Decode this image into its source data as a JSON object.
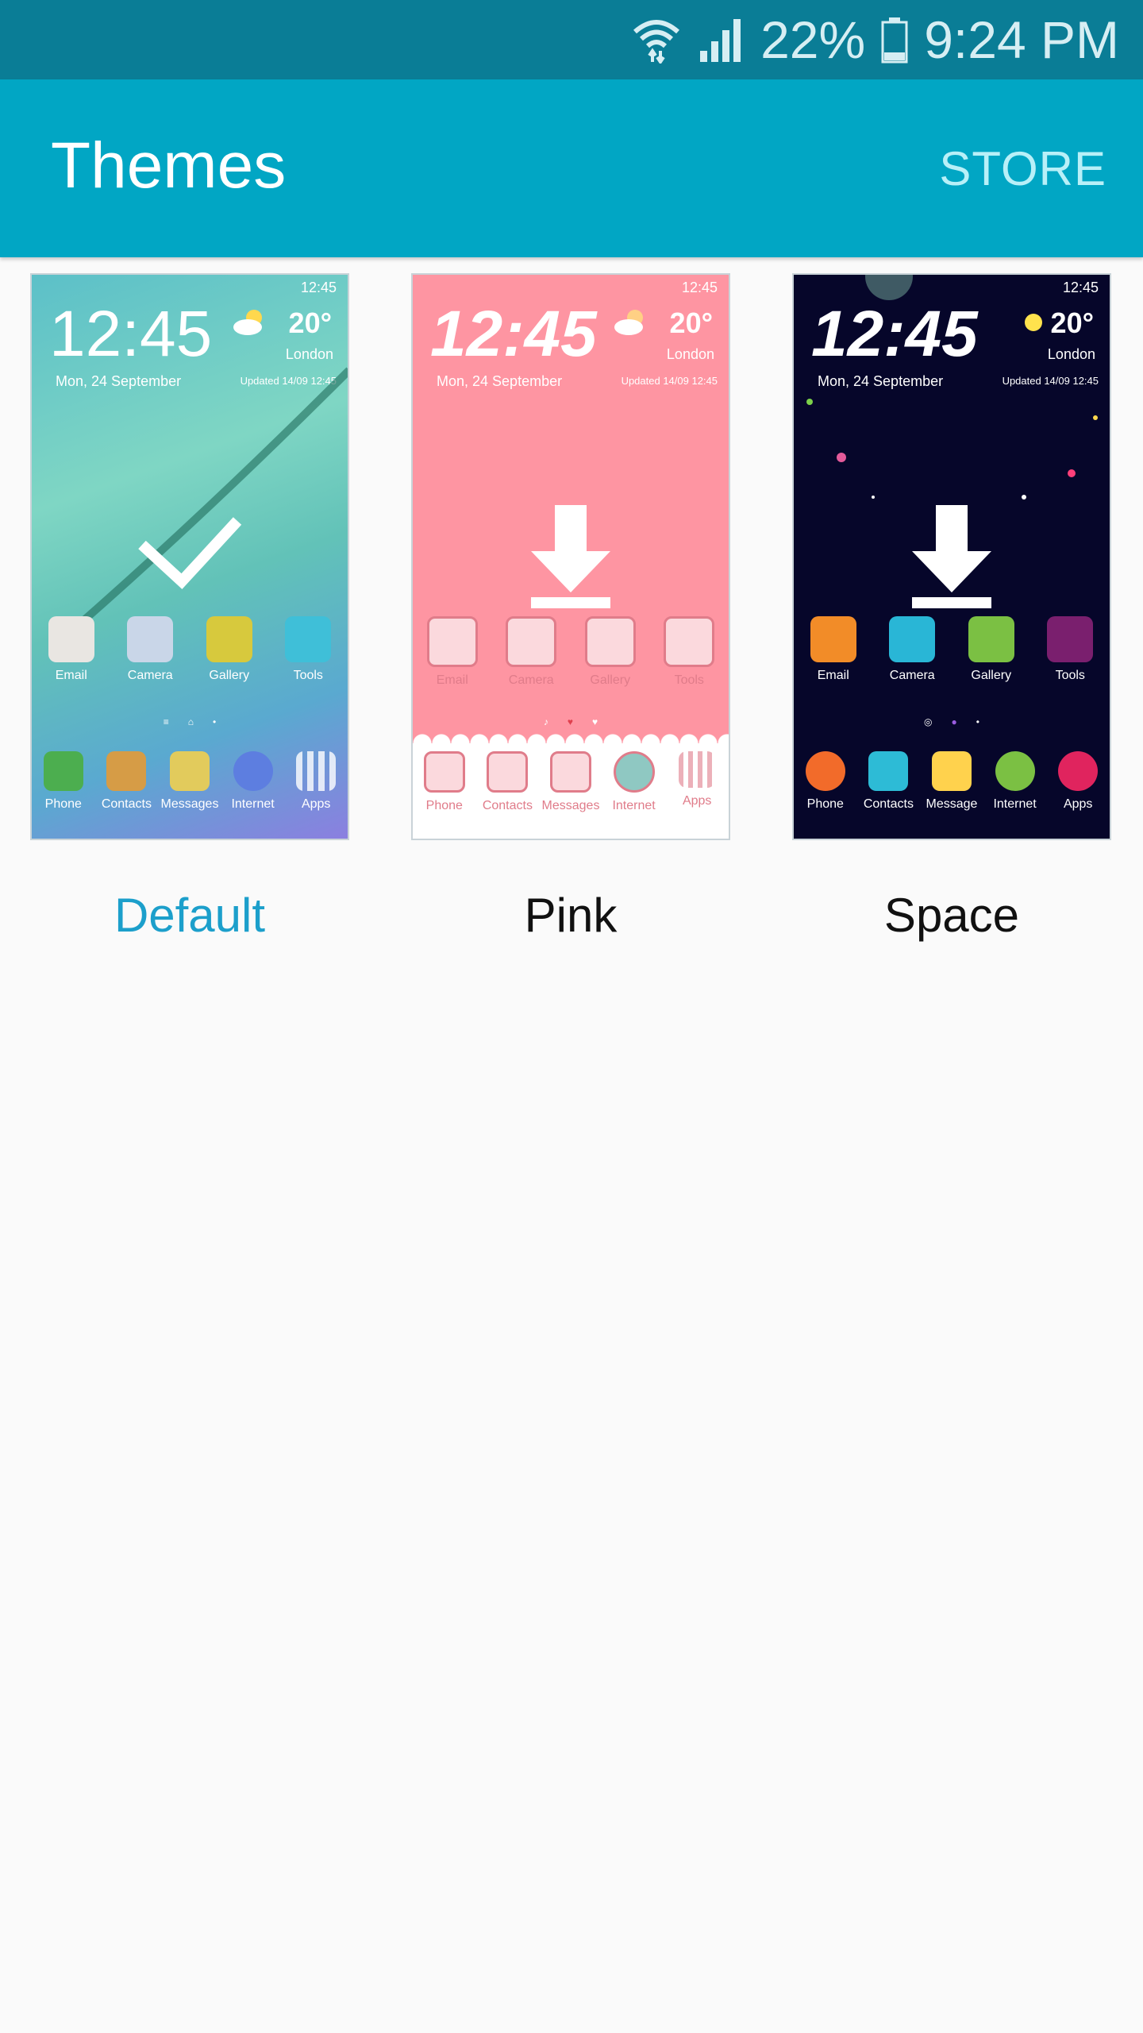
{
  "status_bar": {
    "battery": "22%",
    "time": "9:24 PM"
  },
  "app_bar": {
    "title": "Themes",
    "store_label": "STORE"
  },
  "preview": {
    "status_time": "12:45",
    "clock": "12:45",
    "date": "Mon, 24 September",
    "temperature": "20°",
    "city": "London",
    "updated": "Updated 14/09 12:45"
  },
  "themes": [
    {
      "name": "Default",
      "selected": true,
      "home_apps": [
        "Email",
        "Camera",
        "Gallery",
        "Tools"
      ],
      "dock_apps": [
        "Phone",
        "Contacts",
        "Messages",
        "Internet",
        "Apps"
      ],
      "overlay_icon": "check-icon"
    },
    {
      "name": "Pink",
      "selected": false,
      "home_apps": [
        "Email",
        "Camera",
        "Gallery",
        "Tools"
      ],
      "dock_apps": [
        "Phone",
        "Contacts",
        "Messages",
        "Internet",
        "Apps"
      ],
      "overlay_icon": "download-icon"
    },
    {
      "name": "Space",
      "selected": false,
      "home_apps": [
        "Email",
        "Camera",
        "Gallery",
        "Tools"
      ],
      "dock_apps": [
        "Phone",
        "Contacts",
        "Message",
        "Internet",
        "Apps"
      ],
      "overlay_icon": "download-icon"
    }
  ],
  "colors": {
    "status_bar": "#0a7d96",
    "app_bar": "#01a6c4",
    "store": "#b8f0f8",
    "selected_label": "#1c9fcb",
    "background": "#fafafa"
  }
}
